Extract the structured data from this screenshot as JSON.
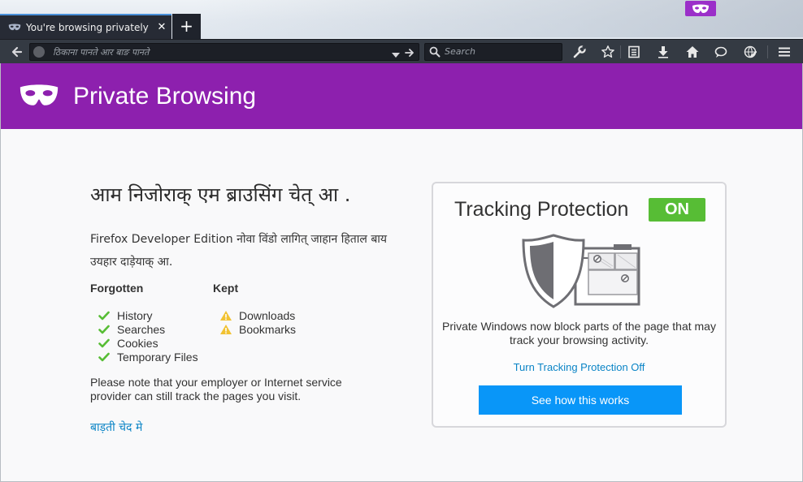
{
  "window": {
    "tab_title": "You're browsing privately",
    "tab_close": "✕",
    "new_tab": "+"
  },
  "toolbar": {
    "url_placeholder": "ठिकाना पानते आर बाङ पानते",
    "search_placeholder": "Search"
  },
  "banner": {
    "title": "Private Browsing"
  },
  "main": {
    "headline": "आम निजोराक् एम ब्राउसिंग चेत् आ .",
    "intro": "Firefox Developer Edition नोवा विंडो लागित् जाहान हिताल बाय उयहार दाड़ेयाक् आ.",
    "forgotten_heading": "Forgotten",
    "kept_heading": "Kept",
    "forgotten_items": [
      "History",
      "Searches",
      "Cookies",
      "Temporary Files"
    ],
    "kept_items": [
      "Downloads",
      "Bookmarks"
    ],
    "note": "Please note that your employer or Internet service provider can still track the pages you visit.",
    "learn_more": "बाड़ती चेद मे"
  },
  "tracking_protection": {
    "title": "Tracking Protection",
    "status": "ON",
    "description": "Private Windows now block parts of the page that may track your browsing activity.",
    "toggle_link": "Turn Tracking Protection Off",
    "button": "See how this works"
  },
  "colors": {
    "banner": "#8d20ae",
    "badge_on": "#57bd35",
    "link": "#0a84c6",
    "primary_button": "#0996f8"
  }
}
